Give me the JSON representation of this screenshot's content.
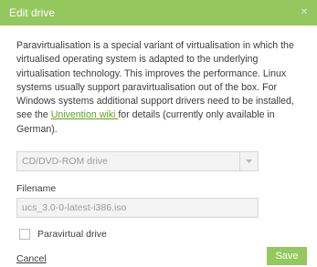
{
  "dialog": {
    "title": "Edit drive",
    "close_glyph": "✕"
  },
  "description": {
    "text_before_link": "Paravirtualisation is a special variant of virtualisation in which the virtualised operating system is adapted to the underlying virtualisation technology. This improves the performance. Linux systems usually support paravirtualisation out of the box. For Windows systems additional support drivers need to be installed, see the ",
    "link_text": "Univention wiki ",
    "text_after_link": "for details (currently only available in German)."
  },
  "drive_type": {
    "selected": "CD/DVD-ROM drive"
  },
  "filename": {
    "label": "Filename",
    "value": "ucs_3.0-0-latest-i386.iso"
  },
  "paravirtual": {
    "label": "Paravirtual drive",
    "checked": false
  },
  "actions": {
    "cancel": "Cancel",
    "save": "Save"
  },
  "colors": {
    "accent": "#94c85f",
    "link": "#5fa221"
  }
}
